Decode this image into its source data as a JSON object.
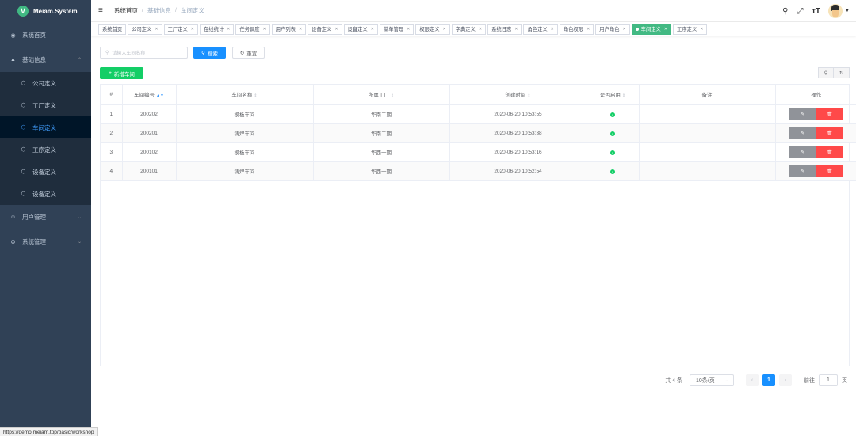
{
  "app": {
    "logo_letter": "V",
    "title": "Meiam.System",
    "accent": "#409eff"
  },
  "sidebar": {
    "home": "系统首页",
    "basic": "基础信息",
    "basic_items": [
      "公司定义",
      "工厂定义",
      "车间定义",
      "工序定义",
      "设备定义",
      "设备定义"
    ],
    "users": "用户管理",
    "system": "系统管理"
  },
  "breadcrumb": [
    "系统首页",
    "基础信息",
    "车间定义"
  ],
  "tags": [
    {
      "label": "系统首页",
      "closable": false
    },
    {
      "label": "公司定义",
      "closable": true
    },
    {
      "label": "工厂定义",
      "closable": true
    },
    {
      "label": "在线统计",
      "closable": true
    },
    {
      "label": "任务调度",
      "closable": true
    },
    {
      "label": "用户列表",
      "closable": true
    },
    {
      "label": "设备定义",
      "closable": true
    },
    {
      "label": "设备定义",
      "closable": true
    },
    {
      "label": "菜单管理",
      "closable": true
    },
    {
      "label": "权限定义",
      "closable": true
    },
    {
      "label": "字典定义",
      "closable": true
    },
    {
      "label": "系统日志",
      "closable": true
    },
    {
      "label": "角色定义",
      "closable": true
    },
    {
      "label": "角色权限",
      "closable": true
    },
    {
      "label": "用户角色",
      "closable": true
    },
    {
      "label": "车间定义",
      "closable": true,
      "active": true
    },
    {
      "label": "工序定义",
      "closable": true
    }
  ],
  "search": {
    "placeholder": "请输入车间名称",
    "search_label": "搜索",
    "reset_label": "重置"
  },
  "add_label": "新增车间",
  "table": {
    "headers": [
      "#",
      "车间编号",
      "车间名称",
      "所属工厂",
      "创建时间",
      "是否启用",
      "备注",
      "操作"
    ],
    "rows": [
      {
        "idx": "1",
        "code": "200202",
        "name": "模板车间",
        "factory": "华南二期",
        "created": "2020-06-20 10:53:55",
        "enabled": true,
        "remark": ""
      },
      {
        "idx": "2",
        "code": "200201",
        "name": "铸焊车间",
        "factory": "华南二期",
        "created": "2020-06-20 10:53:38",
        "enabled": true,
        "remark": ""
      },
      {
        "idx": "3",
        "code": "200102",
        "name": "模板车间",
        "factory": "华西一期",
        "created": "2020-06-20 10:53:16",
        "enabled": true,
        "remark": ""
      },
      {
        "idx": "4",
        "code": "200101",
        "name": "铸焊车间",
        "factory": "华西一期",
        "created": "2020-06-20 10:52:54",
        "enabled": true,
        "remark": ""
      }
    ]
  },
  "pagination": {
    "total": "共 4 条",
    "page_size": "10条/页",
    "current": "1",
    "goto_label": "前往",
    "goto_value": "1",
    "page_unit": "页"
  },
  "status_url": "https://demo.meiam.top/basic/workshop"
}
